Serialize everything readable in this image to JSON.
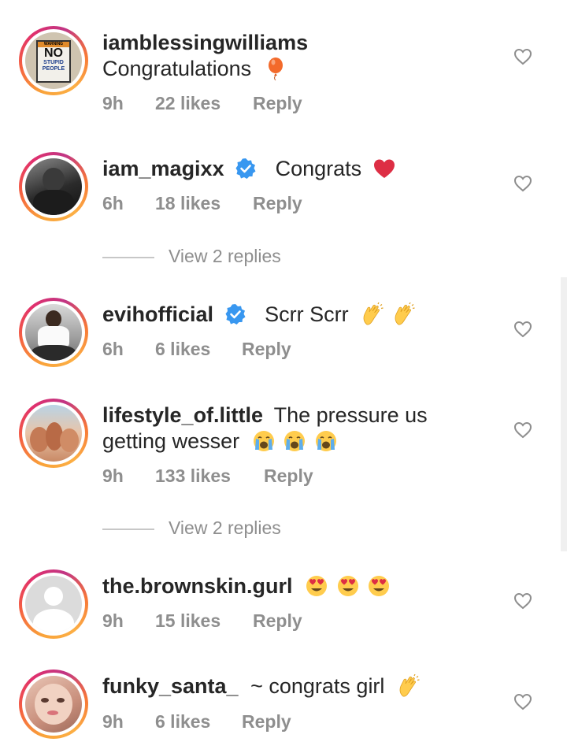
{
  "comments": [
    {
      "username": "iamblessingwilliams",
      "verified": false,
      "text": "Congratulations",
      "emoji": "balloon",
      "time": "9h",
      "likes": "22 likes",
      "reply": "Reply",
      "avatar_caption": [
        "WARNING",
        "NO",
        "STUPID",
        "PEOPLE"
      ]
    },
    {
      "username": "iam_magixx",
      "verified": true,
      "text": "Congrats",
      "emoji": "red-heart",
      "time": "6h",
      "likes": "18 likes",
      "reply": "Reply",
      "view_replies": "View 2 replies"
    },
    {
      "username": "evihofficial",
      "verified": true,
      "text": "Scrr Scrr",
      "emoji": "clapping-hands x2",
      "time": "6h",
      "likes": "6 likes",
      "reply": "Reply"
    },
    {
      "username": "lifestyle_of.little",
      "verified": false,
      "text": "The pressure us",
      "text2": "getting wesser",
      "emoji": "loudly-crying x3",
      "time": "9h",
      "likes": "133 likes",
      "reply": "Reply",
      "view_replies": "View 2 replies"
    },
    {
      "username": "the.brownskin.gurl",
      "verified": false,
      "text": "",
      "emoji": "heart-eyes x3",
      "time": "9h",
      "likes": "15 likes",
      "reply": "Reply"
    },
    {
      "username": "funky_santa_",
      "verified": false,
      "text": "~ congrats girl",
      "emoji": "clapping-hands",
      "time": "9h",
      "likes": "6 likes",
      "reply": "Reply"
    }
  ],
  "colors": {
    "text": "#262626",
    "meta": "#8e8e8e",
    "verified": "#3897f0",
    "heart_icon": "#8e8e8e"
  }
}
